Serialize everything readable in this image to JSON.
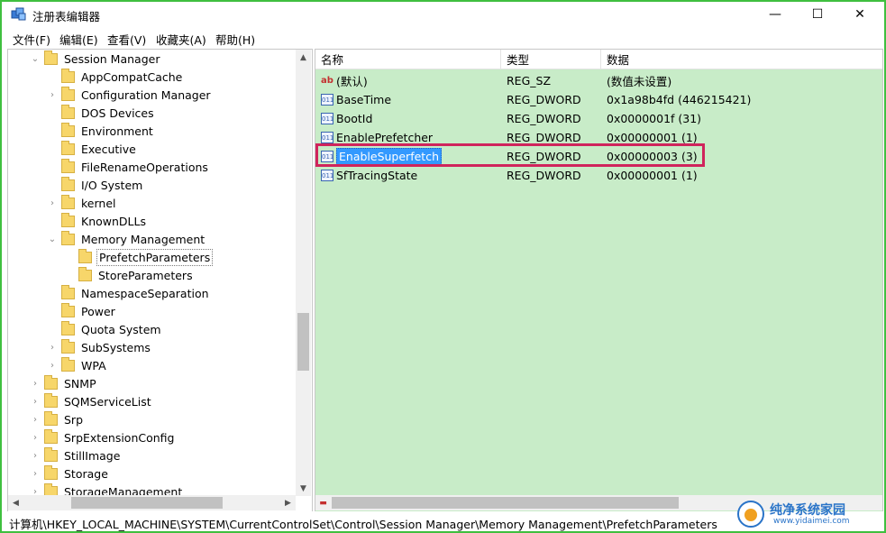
{
  "window": {
    "title": "注册表编辑器",
    "controls": {
      "minimize": "—",
      "maximize": "☐",
      "close": "✕"
    }
  },
  "menu": [
    "文件(F)",
    "编辑(E)",
    "查看(V)",
    "收藏夹(A)",
    "帮助(H)"
  ],
  "tree": {
    "items": [
      {
        "label": "Session Manager",
        "expander": "⌄"
      },
      {
        "label": "AppCompatCache",
        "expander": ""
      },
      {
        "label": "Configuration Manager",
        "expander": "›"
      },
      {
        "label": "DOS Devices",
        "expander": ""
      },
      {
        "label": "Environment",
        "expander": ""
      },
      {
        "label": "Executive",
        "expander": ""
      },
      {
        "label": "FileRenameOperations",
        "expander": ""
      },
      {
        "label": "I/O System",
        "expander": ""
      },
      {
        "label": "kernel",
        "expander": "›"
      },
      {
        "label": "KnownDLLs",
        "expander": ""
      },
      {
        "label": "Memory Management",
        "expander": "⌄"
      },
      {
        "label": "PrefetchParameters",
        "expander": "",
        "selected": true
      },
      {
        "label": "StoreParameters",
        "expander": ""
      },
      {
        "label": "NamespaceSeparation",
        "expander": ""
      },
      {
        "label": "Power",
        "expander": ""
      },
      {
        "label": "Quota System",
        "expander": ""
      },
      {
        "label": "SubSystems",
        "expander": "›"
      },
      {
        "label": "WPA",
        "expander": "›"
      },
      {
        "label": "SNMP",
        "expander": "›"
      },
      {
        "label": "SQMServiceList",
        "expander": "›"
      },
      {
        "label": "Srp",
        "expander": "›"
      },
      {
        "label": "SrpExtensionConfig",
        "expander": "›"
      },
      {
        "label": "StillImage",
        "expander": "›"
      },
      {
        "label": "Storage",
        "expander": "›"
      },
      {
        "label": "StorageManagement",
        "expander": "›"
      }
    ]
  },
  "values": {
    "headers": {
      "name": "名称",
      "type": "类型",
      "data": "数据"
    },
    "rows": [
      {
        "icon": "ab",
        "name": "(默认)",
        "type": "REG_SZ",
        "data": "(数值未设置)"
      },
      {
        "icon": "011",
        "name": "BaseTime",
        "type": "REG_DWORD",
        "data": "0x1a98b4fd (446215421)"
      },
      {
        "icon": "011",
        "name": "BootId",
        "type": "REG_DWORD",
        "data": "0x0000001f (31)"
      },
      {
        "icon": "011",
        "name": "EnablePrefetcher",
        "type": "REG_DWORD",
        "data": "0x00000001 (1)"
      },
      {
        "icon": "011",
        "name": "EnableSuperfetch",
        "type": "REG_DWORD",
        "data": "0x00000003 (3)",
        "selected": true
      },
      {
        "icon": "011",
        "name": "SfTracingState",
        "type": "REG_DWORD",
        "data": "0x00000001 (1)"
      }
    ]
  },
  "status": {
    "path": "计算机\\HKEY_LOCAL_MACHINE\\SYSTEM\\CurrentControlSet\\Control\\Session Manager\\Memory Management\\PrefetchParameters"
  },
  "watermark": {
    "title": "纯净系统家园",
    "url": "www.yidaimei.com"
  },
  "colors": {
    "border": "#3fbf3f",
    "values_bg": "#c8ecc8",
    "highlight": "#d0245c",
    "selection": "#3399ff"
  }
}
